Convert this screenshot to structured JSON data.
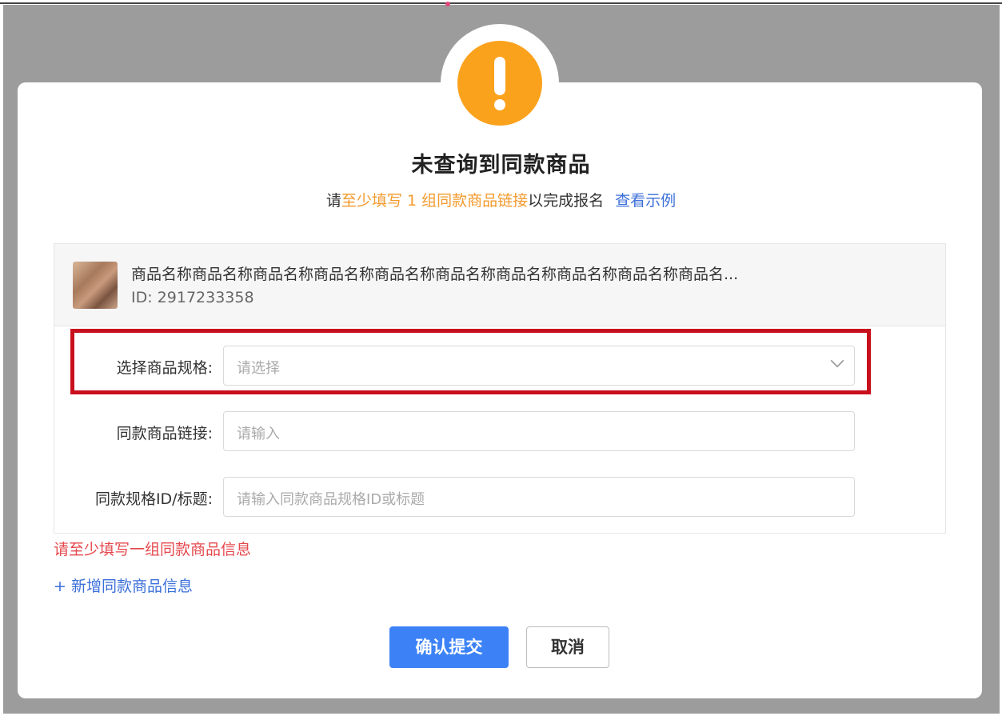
{
  "dialog": {
    "title": "未查询到同款商品",
    "subtitle": {
      "prefix": "请",
      "highlight": "至少填写 1 组同款商品链接",
      "suffix": "以完成报名",
      "example_link": "查看示例"
    },
    "icon": "warning-exclamation-icon",
    "accent_color": "#fba21d"
  },
  "product": {
    "name": "商品名称商品名称商品名称商品名称商品名称商品名称商品名称商品名称商品名称商品名...",
    "id_text": "ID: 2917233358"
  },
  "form": {
    "spec": {
      "label": "选择商品规格:",
      "placeholder": "请选择"
    },
    "link": {
      "label": "同款商品链接:",
      "placeholder": "请输入"
    },
    "spec_id": {
      "label": "同款规格ID/标题:",
      "placeholder": "请输入同款商品规格ID或标题"
    }
  },
  "error_message": "请至少填写一组同款商品信息",
  "add_link": "+ 新增同款商品信息",
  "buttons": {
    "confirm": "确认提交",
    "cancel": "取消"
  },
  "colors": {
    "primary": "#3c82f6",
    "link": "#3b6fd9",
    "error": "#e5484d",
    "highlight_box": "#c80f1e"
  }
}
